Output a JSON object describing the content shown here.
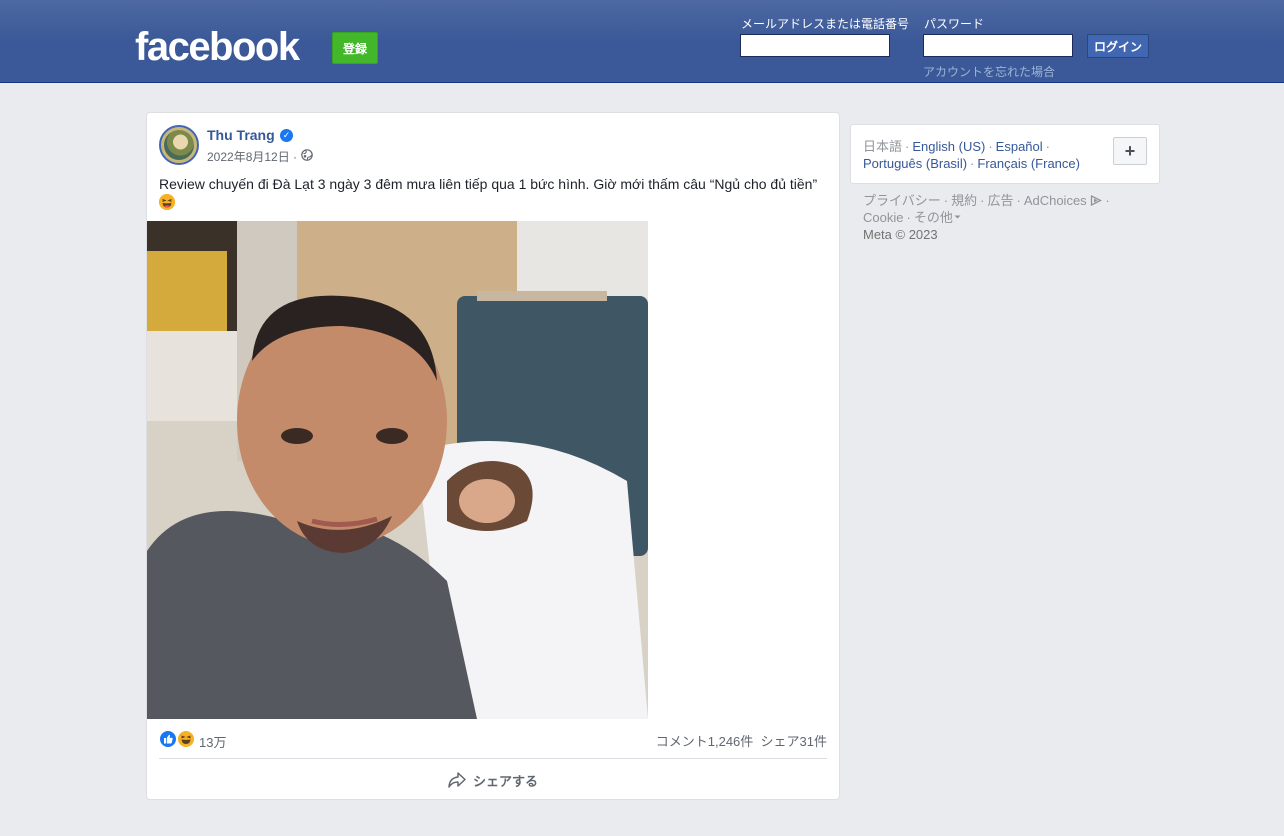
{
  "header": {
    "logo": "facebook",
    "signup_label": "登録",
    "email_label": "メールアドレスまたは電話番号",
    "password_label": "パスワード",
    "login_label": "ログイン",
    "forgot_label": "アカウントを忘れた場合"
  },
  "post": {
    "author": "Thu Trang",
    "verified": true,
    "date": "2022年8月12日 ·",
    "privacy_icon": "globe-icon",
    "text": "Review chuyến đi Đà Lạt 3 ngày 3 đêm mưa liên tiếp qua 1 bức hình. Giờ mới thấm câu “Ngủ cho đủ tiền”",
    "text_emoji": "laughing-emoji",
    "reaction_icons": [
      "like-icon",
      "haha-icon"
    ],
    "reaction_count": "13万",
    "comments": "コメント1,246件",
    "shares": "シェア31件",
    "share_button": "シェアする"
  },
  "sidebar": {
    "languages": [
      {
        "label": "日本語",
        "current": true
      },
      {
        "label": "English (US)",
        "current": false
      },
      {
        "label": "Español",
        "current": false
      },
      {
        "label": "Português (Brasil)",
        "current": false
      },
      {
        "label": "Français (France)",
        "current": false
      }
    ],
    "more_languages": "+",
    "footer_links": [
      "プライバシー",
      "規約",
      "広告",
      "AdChoices",
      "Cookie",
      "その他"
    ],
    "copyright": "Meta © 2023"
  },
  "colors": {
    "header_bg": "#3b5998",
    "signup_green": "#42b72a",
    "link_blue": "#365899",
    "page_bg": "#e9ebee"
  }
}
